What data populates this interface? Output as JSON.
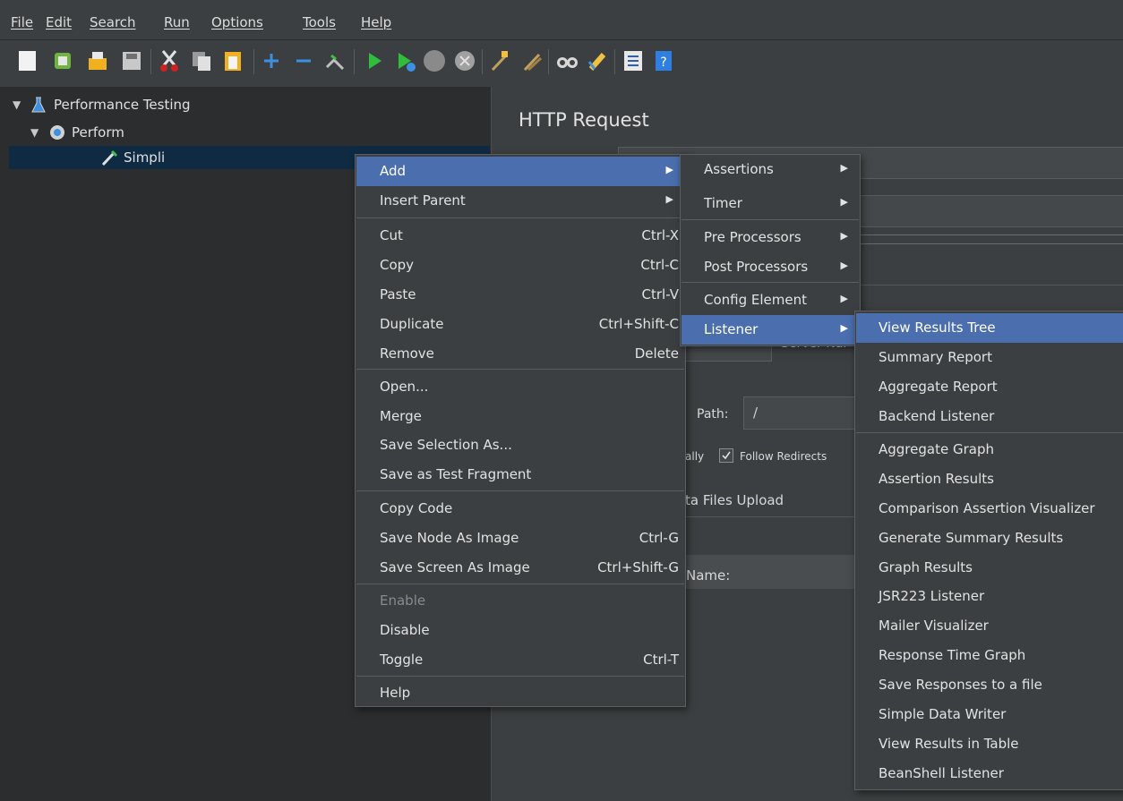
{
  "menubar": {
    "items": [
      "File",
      "Edit",
      "Search",
      "Run",
      "Options",
      "Tools",
      "Help"
    ]
  },
  "toolbar": {
    "icons": [
      "new-icon",
      "templates-icon",
      "open-icon",
      "save-icon",
      "cut-icon",
      "copy-icon",
      "paste-icon",
      "expand-icon",
      "collapse-icon",
      "toggle-icon",
      "start-icon",
      "start-no-pause-icon",
      "stop-icon",
      "shutdown-icon",
      "clear-icon",
      "clear-all-icon",
      "search-icon",
      "reset-search-icon",
      "function-helper-icon",
      "help-icon"
    ]
  },
  "tree": {
    "items": [
      {
        "label": "Performance Testing",
        "icon": "test-plan-icon"
      },
      {
        "label": "Perform",
        "icon": "thread-group-icon"
      },
      {
        "label": "Simpli",
        "icon": "sampler-icon"
      }
    ]
  },
  "main": {
    "title": "HTTP Request",
    "server_name_label": "Server Nai",
    "path_label": "Path:",
    "path_value": "/",
    "follow_redirects_prefix": "ally",
    "follow_redirects_label": "Follow Redirects",
    "tabs_partial": "ta  Files Upload",
    "name_label": "Name:"
  },
  "context_menu": {
    "items": [
      {
        "label": "Add",
        "submenu": true,
        "highlighted": true
      },
      {
        "label": "Insert Parent",
        "submenu": true
      },
      {
        "sep": true
      },
      {
        "label": "Cut",
        "shortcut": "Ctrl-X"
      },
      {
        "label": "Copy",
        "shortcut": "Ctrl-C"
      },
      {
        "label": "Paste",
        "shortcut": "Ctrl-V"
      },
      {
        "label": "Duplicate",
        "shortcut": "Ctrl+Shift-C"
      },
      {
        "label": "Remove",
        "shortcut": "Delete"
      },
      {
        "sep": true
      },
      {
        "label": "Open..."
      },
      {
        "label": "Merge"
      },
      {
        "label": "Save Selection As..."
      },
      {
        "label": "Save as Test Fragment"
      },
      {
        "sep": true
      },
      {
        "label": "Copy Code"
      },
      {
        "label": "Save Node As Image",
        "shortcut": "Ctrl-G"
      },
      {
        "label": "Save Screen As Image",
        "shortcut": "Ctrl+Shift-G"
      },
      {
        "sep": true
      },
      {
        "label": "Enable",
        "disabled": true
      },
      {
        "label": "Disable"
      },
      {
        "label": "Toggle",
        "shortcut": "Ctrl-T"
      },
      {
        "sep": true
      },
      {
        "label": "Help"
      }
    ]
  },
  "add_submenu": {
    "items": [
      {
        "label": "Assertions",
        "submenu": true
      },
      {
        "label": "Timer",
        "submenu": true
      },
      {
        "sep": true
      },
      {
        "label": "Pre Processors",
        "submenu": true
      },
      {
        "label": "Post Processors",
        "submenu": true
      },
      {
        "sep": true
      },
      {
        "label": "Config Element",
        "submenu": true
      },
      {
        "label": "Listener",
        "submenu": true,
        "highlighted": true
      }
    ]
  },
  "listener_submenu": {
    "items": [
      {
        "label": "View Results Tree",
        "highlighted": true
      },
      {
        "label": "Summary Report"
      },
      {
        "label": "Aggregate Report"
      },
      {
        "label": "Backend Listener"
      },
      {
        "sep": true
      },
      {
        "label": "Aggregate Graph"
      },
      {
        "label": "Assertion Results"
      },
      {
        "label": "Comparison Assertion Visualizer"
      },
      {
        "label": "Generate Summary Results"
      },
      {
        "label": "Graph Results"
      },
      {
        "label": "JSR223 Listener"
      },
      {
        "label": "Mailer Visualizer"
      },
      {
        "label": "Response Time Graph"
      },
      {
        "label": "Save Responses to a file"
      },
      {
        "label": "Simple Data Writer"
      },
      {
        "label": "View Results in Table"
      },
      {
        "label": "BeanShell Listener"
      }
    ]
  },
  "colors": {
    "highlight": "#4b6eaf",
    "panel": "#3c3f41",
    "tree_bg": "#2b2d2f",
    "tree_selected": "#0f2b44"
  }
}
